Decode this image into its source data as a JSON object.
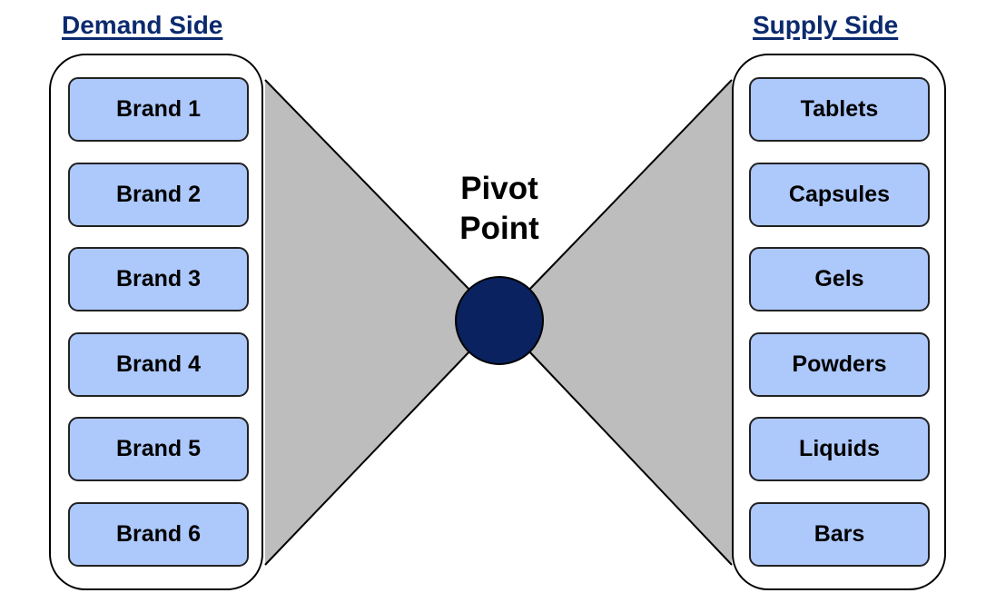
{
  "demand_side": {
    "title": "Demand Side",
    "items": [
      "Brand 1",
      "Brand 2",
      "Brand 3",
      "Brand 4",
      "Brand 5",
      "Brand 6"
    ]
  },
  "supply_side": {
    "title": "Supply Side",
    "items": [
      "Tablets",
      "Capsules",
      "Gels",
      "Powders",
      "Liquids",
      "Bars"
    ]
  },
  "pivot": {
    "line1": "Pivot",
    "line2": "Point"
  },
  "colors": {
    "heading": "#0b2a6e",
    "item_fill": "#adc8fb",
    "pivot_fill": "#0a2260",
    "funnel_fill": "#bdbdbd"
  }
}
